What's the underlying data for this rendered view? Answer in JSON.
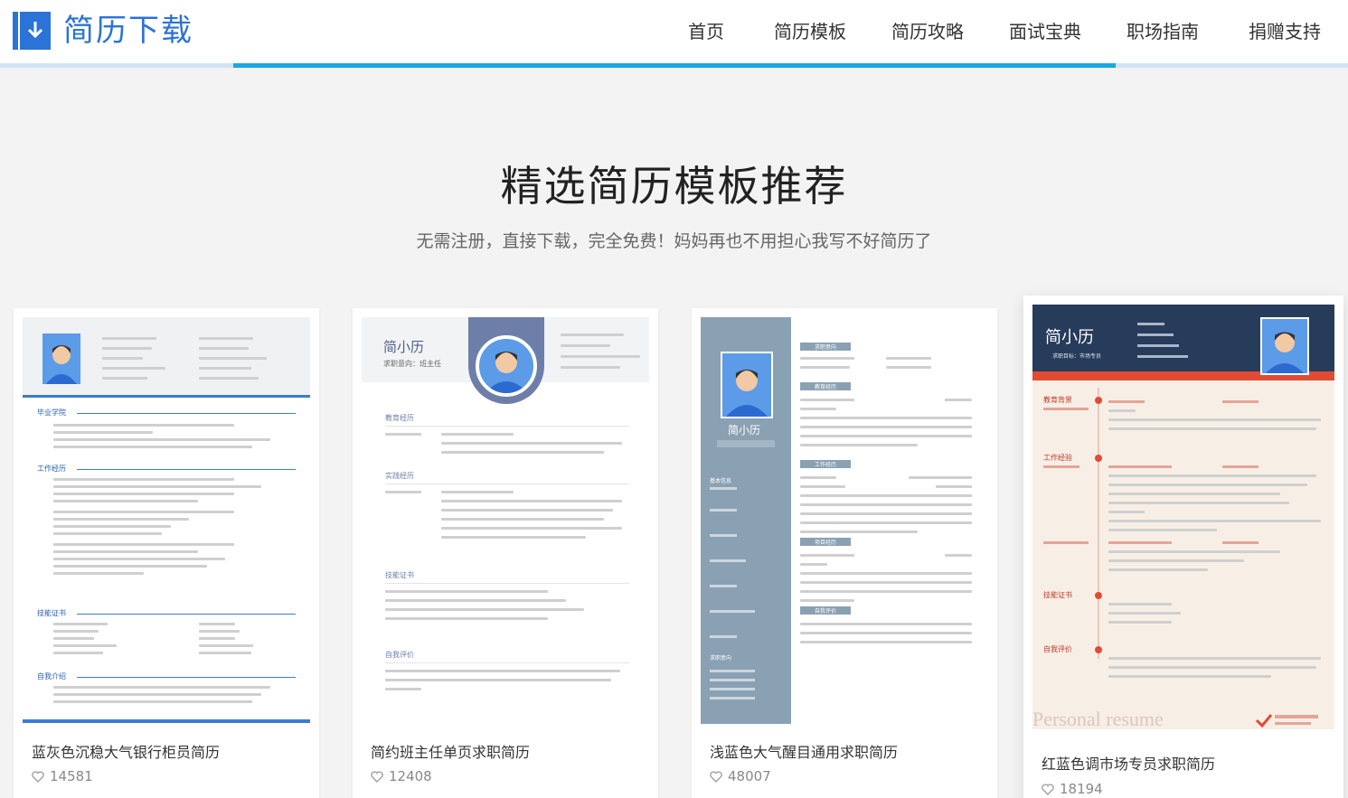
{
  "header": {
    "logo_text": "简历下载",
    "nav": [
      "首页",
      "简历模板",
      "简历攻略",
      "面试宝典",
      "职场指南",
      "捐赠支持"
    ]
  },
  "section": {
    "title": "精选简历模板推荐",
    "subtitle": "无需注册，直接下载，完全免费！妈妈再也不用担心我写不好简历了"
  },
  "cards": [
    {
      "name": "蓝灰色沉稳大气银行柜员简历",
      "likes": "14581",
      "thumb": {
        "s1": "毕业学院",
        "s2": "工作经历",
        "s3": "技能证书",
        "s4": "自我介绍"
      }
    },
    {
      "name": "简约班主任单页求职简历",
      "likes": "12408",
      "thumb": {
        "name": "简小历",
        "objective": "求职意向：班主任",
        "s1": "教育经历",
        "s2": "实践经历",
        "s3": "技能证书",
        "s4": "自我评价"
      }
    },
    {
      "name": "浅蓝色大气醒目通用求职简历",
      "likes": "48007",
      "thumb": {
        "name": "简小历",
        "side1": "基本信息",
        "side2": "求职意向",
        "s1": "求职意向",
        "s2": "教育经历",
        "s3": "工作经历",
        "s4": "项目经历",
        "s5": "自我评价"
      }
    },
    {
      "name": "红蓝色调市场专员求职简历",
      "likes": "18194",
      "thumb": {
        "name": "简小历",
        "objective": "求职目标：市场专员",
        "s1": "教育背景",
        "s2": "工作经验",
        "s3": "技能证书",
        "s4": "自我评价",
        "footer": "Personal resume"
      }
    }
  ],
  "colors": {
    "brand": "#2b73d6",
    "nav_active_line": "#1aa7e2"
  }
}
